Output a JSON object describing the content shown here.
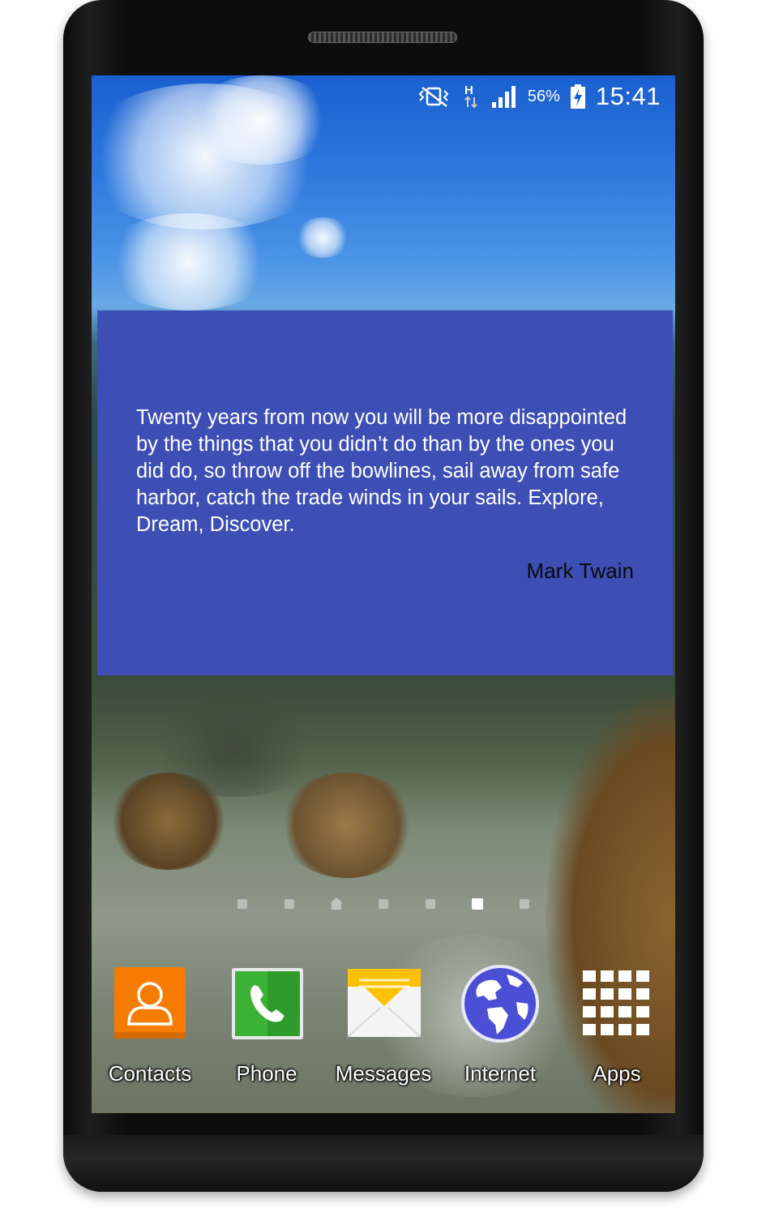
{
  "status_bar": {
    "icons": [
      "vibrate-icon",
      "network-h-icon",
      "signal-icon",
      "battery-charging-icon"
    ],
    "battery_percent": "56%",
    "time": "15:41"
  },
  "quote_widget": {
    "text": "Twenty years from now you will be more disappointed by the things that you didn’t do than by the ones you did do, so throw off the bowlines, sail away from safe harbor, catch the trade winds in your sails.  Explore, Dream, Discover.",
    "author": "Mark Twain",
    "background_color": "#3d4fb5"
  },
  "home_pages": {
    "count": 7,
    "active_index": 5,
    "home_index": 2
  },
  "dock": {
    "apps": [
      {
        "label": "Contacts",
        "icon": "contacts-icon",
        "color": "#f57c00"
      },
      {
        "label": "Phone",
        "icon": "phone-icon",
        "color": "#2e9c2a"
      },
      {
        "label": "Messages",
        "icon": "messages-icon",
        "color": "#ffc107"
      },
      {
        "label": "Internet",
        "icon": "globe-icon",
        "color": "#4b4fd6"
      },
      {
        "label": "Apps",
        "icon": "apps-grid-icon",
        "color": "#ffffff"
      }
    ]
  }
}
